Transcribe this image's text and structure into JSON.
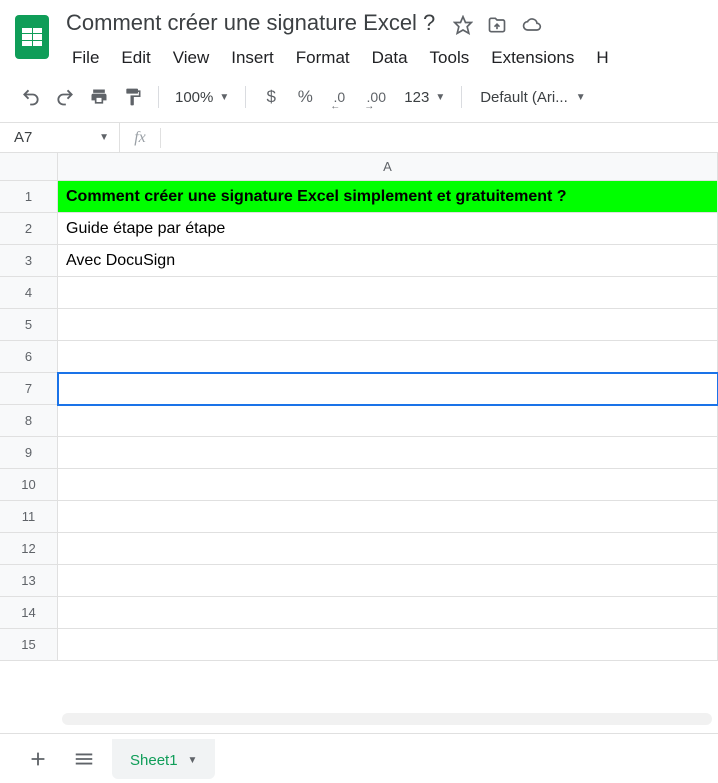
{
  "doc_title": "Comment créer une signature Excel ?",
  "menu": {
    "file": "File",
    "edit": "Edit",
    "view": "View",
    "insert": "Insert",
    "format": "Format",
    "data": "Data",
    "tools": "Tools",
    "extensions": "Extensions",
    "help": "H"
  },
  "toolbar": {
    "zoom": "100%",
    "currency": "$",
    "percent": "%",
    "dec_dec": ".0",
    "dec_inc": ".00",
    "numfmt": "123",
    "font": "Default (Ari..."
  },
  "namebox": "A7",
  "columns": [
    "A"
  ],
  "rows": [
    "1",
    "2",
    "3",
    "4",
    "5",
    "6",
    "7",
    "8",
    "9",
    "10",
    "11",
    "12",
    "13",
    "14",
    "15"
  ],
  "selected_row": 7,
  "cells": {
    "A1": "Comment créer une signature Excel simplement et gratuitement ?",
    "A2": "Guide étape par étape",
    "A3": "Avec DocuSign"
  },
  "highlight_row": 1,
  "sheetbar": {
    "sheet1": "Sheet1"
  }
}
